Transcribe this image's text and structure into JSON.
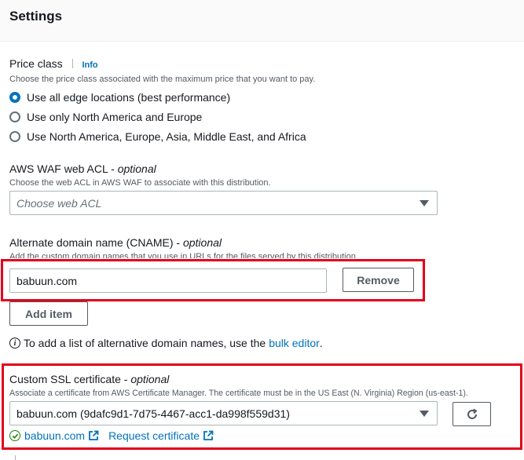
{
  "header": {
    "title": "Settings"
  },
  "price_class": {
    "label": "Price class",
    "info": "Info",
    "description": "Choose the price class associated with the maximum price that you want to pay.",
    "options": [
      {
        "label": "Use all edge locations (best performance)",
        "checked": true
      },
      {
        "label": "Use only North America and Europe",
        "checked": false
      },
      {
        "label": "Use North America, Europe, Asia, Middle East, and Africa",
        "checked": false
      }
    ]
  },
  "waf": {
    "label": "AWS WAF web ACL - ",
    "label_optional": "optional",
    "description": "Choose the web ACL in AWS WAF to associate with this distribution.",
    "placeholder": "Choose web ACL"
  },
  "cname": {
    "label": "Alternate domain name (CNAME) - ",
    "label_optional": "optional",
    "description": "Add the custom domain names that you use in URLs for the files served by this distribution.",
    "value": "babuun.com",
    "remove_label": "Remove",
    "add_label": "Add item"
  },
  "bulk_info": {
    "text": "To add a list of alternative domain names, use the ",
    "link": "bulk editor",
    "suffix": "."
  },
  "ssl": {
    "label": "Custom SSL certificate - ",
    "label_optional": "optional",
    "description": "Associate a certificate from AWS Certificate Manager. The certificate must be in the US East (N. Virginia) Region (us-east-1).",
    "value": "babuun.com (9dafc9d1-7d75-4467-acc1-da998f559d31)",
    "status_link": "babuun.com",
    "request_link": "Request certificate"
  },
  "colors": {
    "accent": "#0073bb",
    "highlight": "#e3001b",
    "success": "#1d8102"
  }
}
